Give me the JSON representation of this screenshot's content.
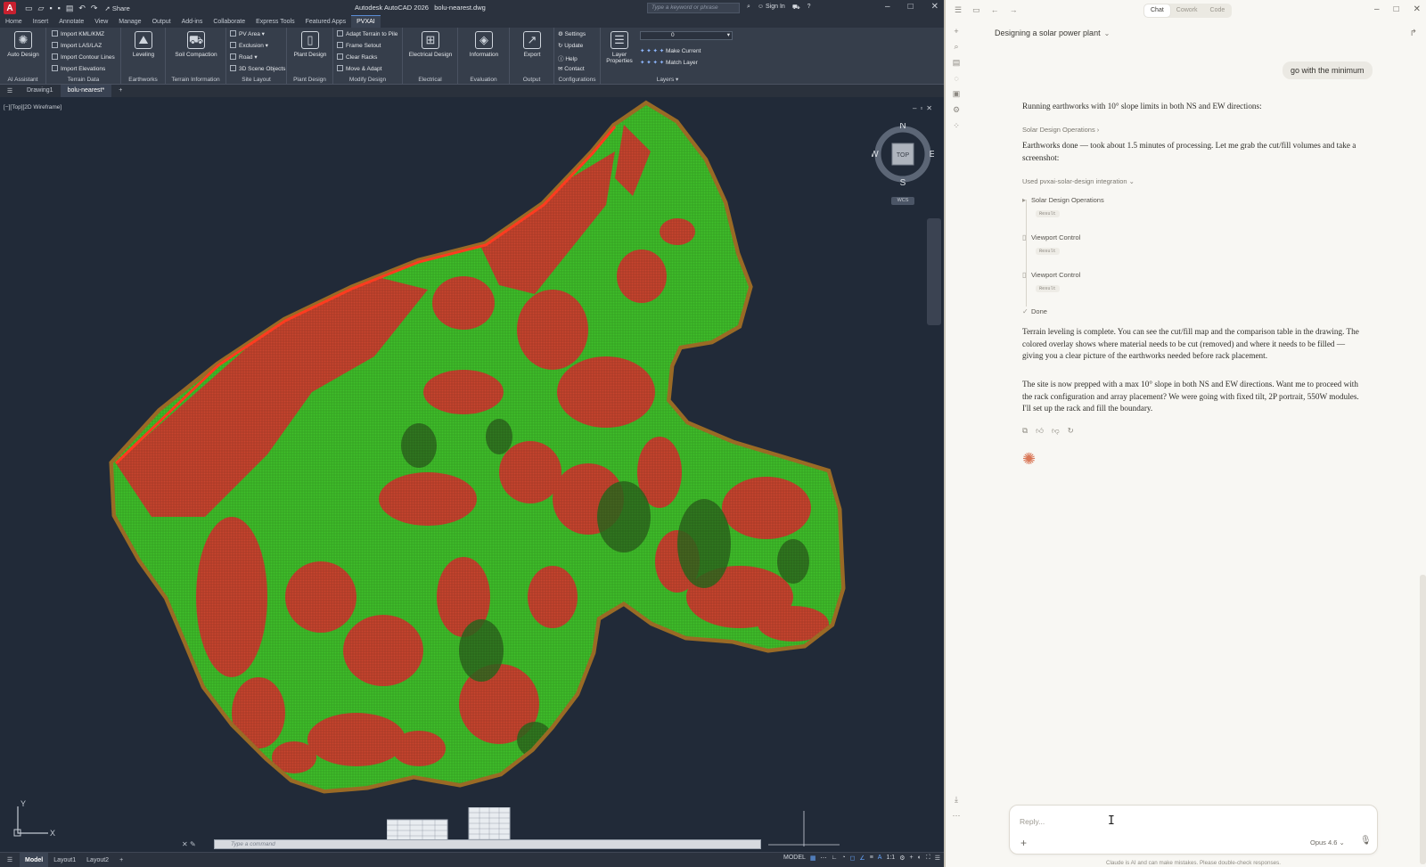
{
  "acad": {
    "app_letter": "A",
    "window_title": "Autodesk AutoCAD 2026",
    "file_title": "bolu-nearest.dwg",
    "share": "Share",
    "search_placeholder": "Type a keyword or phrase",
    "sign_in": "Sign In",
    "ribbon_tabs": [
      "Home",
      "Insert",
      "Annotate",
      "View",
      "Manage",
      "Output",
      "Add-ins",
      "Collaborate",
      "Express Tools",
      "Featured Apps",
      "PVXAI"
    ],
    "active_tab": "PVXAI",
    "ribbon": {
      "auto_design": "Auto Design",
      "ai_assistant": "AI Assistant",
      "import_kml": "Import KML/KMZ",
      "import_las": "Import LAS/LAZ",
      "import_contour": "Import Contour Lines",
      "import_elev": "Import Elevations",
      "terrain_data": "Terrain Data",
      "leveling": "Leveling",
      "earthworks": "Earthworks",
      "soil_compaction": "Soil Compaction",
      "terrain_info": "Terrain Information",
      "pv_area": "PV Area",
      "exclusion": "Exclusion",
      "road": "Road",
      "scene_objects": "3D Scene Objects",
      "site_layout": "Site Layout",
      "plant_design_btn": "Plant Design",
      "plant_design": "Plant Design",
      "adapt_terrain": "Adapt Terrain to Pile",
      "frame_setout": "Frame Setout",
      "clear_racks": "Clear Racks",
      "move_adapt": "Move & Adapt",
      "modify_design": "Modify Design",
      "electrical_design": "Electrical Design",
      "electrical": "Electrical",
      "information": "Information",
      "evaluation": "Evaluation",
      "export": "Export",
      "output": "Output",
      "settings": "Settings",
      "update": "Update",
      "help": "Help",
      "contact": "Contact",
      "configurations": "Configurations",
      "layer_properties": "Layer Properties",
      "layer_value": "0",
      "make_current": "Make Current",
      "match_layer": "Match Layer",
      "layers": "Layers"
    },
    "doc_tabs": [
      "Drawing1",
      "bolu-nearest*"
    ],
    "active_doc": "bolu-nearest*",
    "view_label": "[−][Top][2D Wireframe]",
    "compass": {
      "n": "N",
      "s": "S",
      "e": "E",
      "w": "W",
      "cube": "TOP",
      "wcs": "WCS"
    },
    "ucs": {
      "x": "X",
      "y": "Y"
    },
    "command_placeholder": "Type a command",
    "layout_tabs": [
      "Model",
      "Layout1",
      "Layout2"
    ],
    "status_model": "MODEL",
    "scale": "1:1",
    "colors": {
      "cut": "#c8452e",
      "fill": "#3fbf2a",
      "edge": "#8a5a20",
      "background": "#212a38"
    }
  },
  "claude": {
    "mode_tabs": [
      "Chat",
      "Cowork",
      "Code"
    ],
    "active_mode": "Chat",
    "conversation_title": "Designing a solar power plant",
    "user_message": "go with the minimum",
    "assistant": {
      "p1": "Running earthworks with 10° slope limits in both NS and EW directions:",
      "tool_link": "Solar Design Operations",
      "p2": "Earthworks done — took about 1.5 minutes of processing. Let me grab the cut/fill volumes and take a screenshot:",
      "integration": "Used pvxai-solar-design integration",
      "steps": [
        {
          "label": "Solar Design Operations",
          "result": "Result"
        },
        {
          "label": "Viewport Control",
          "result": "Result"
        },
        {
          "label": "Viewport Control",
          "result": "Result"
        }
      ],
      "done": "Done",
      "p3": "Terrain leveling is complete. You can see the cut/fill map and the comparison table in the drawing. The colored overlay shows where material needs to be cut (removed) and where it needs to be filled — giving you a clear picture of the earthworks needed before rack placement.",
      "p4": "The site is now prepped with a max 10° slope in both NS and EW directions. Want me to proceed with the rack configuration and array placement? We were going with fixed tilt, 2P portrait, 550W modules. I'll set up the rack and fill the boundary."
    },
    "reply_placeholder": "Reply...",
    "model": "Opus 4.6",
    "disclaimer": "Claude is AI and can make mistakes. Please double-check responses.",
    "accent": "#d97757"
  }
}
